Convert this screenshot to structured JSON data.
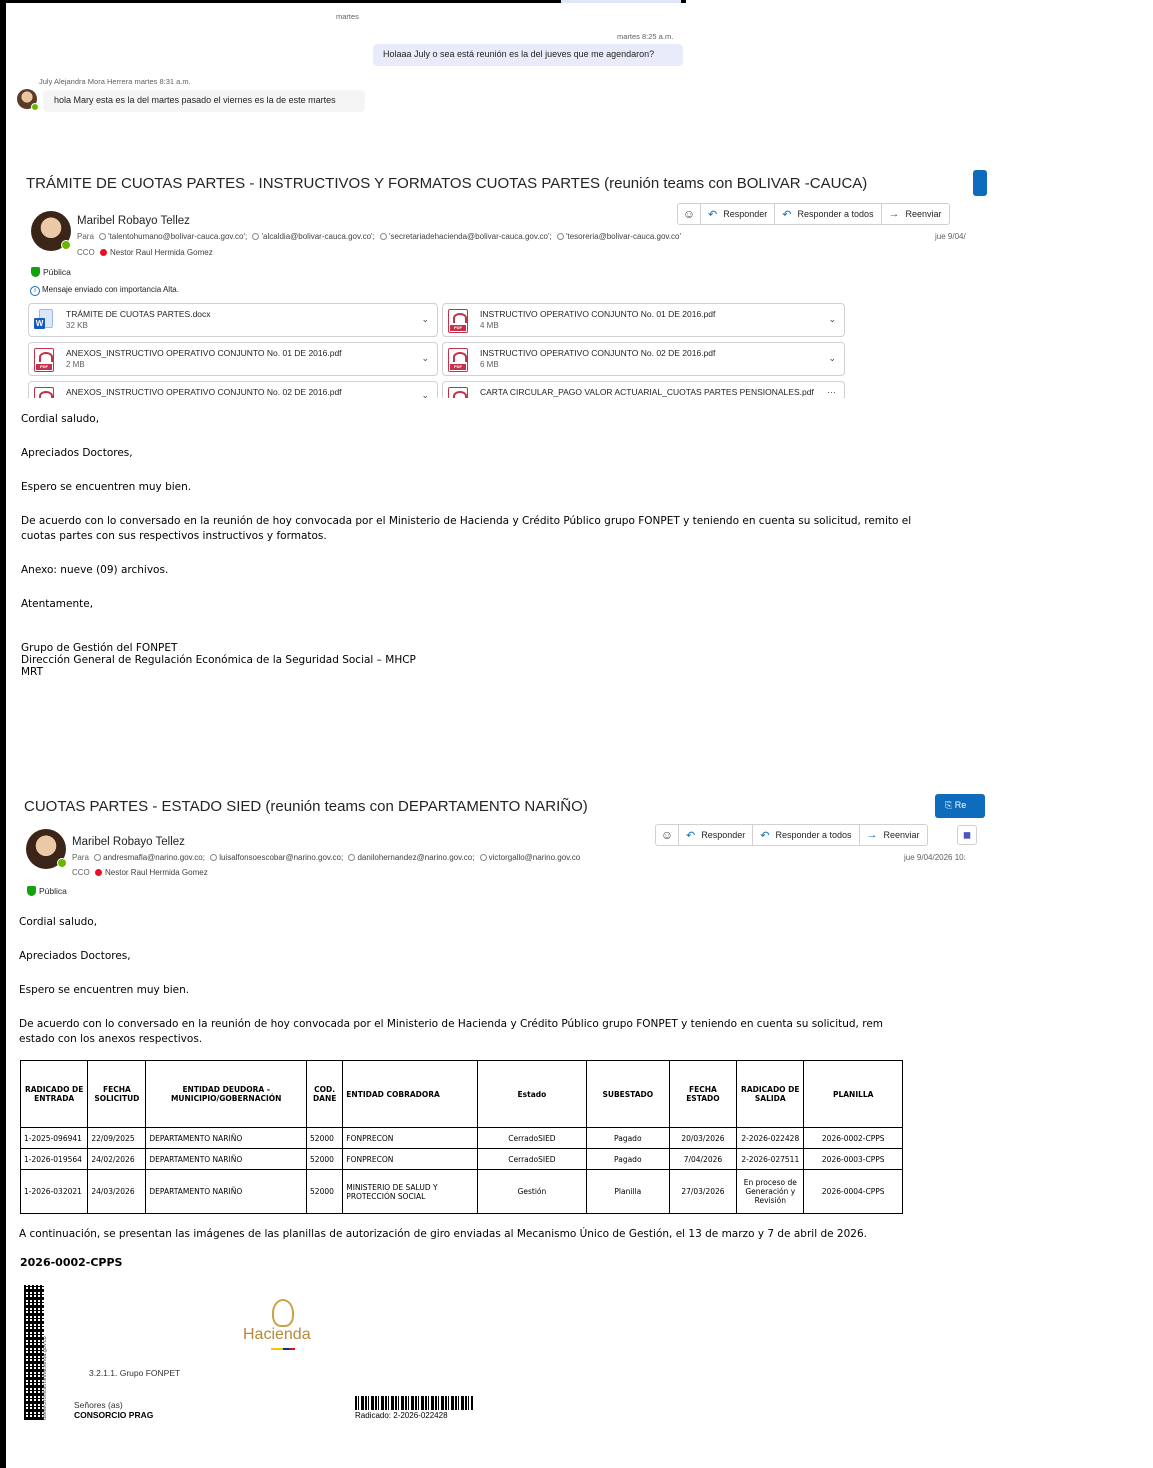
{
  "chat": {
    "day_separator": "martes",
    "my_time": "martes 8:25 a.m.",
    "my_message": "Holaaa July o sea está reunión es la del jueves que me agendaron?",
    "their_header": "July Alejandra Mora Herrera  martes 8:31 a.m.",
    "their_message": "hola Mary esta es la del martes pasado el viernes es la de este martes"
  },
  "email1": {
    "subject": "TRÁMITE DE CUOTAS PARTES  - INSTRUCTIVOS Y FORMATOS CUOTAS PARTES (reunión teams con BOLIVAR -CAUCA)",
    "sender": "Maribel Robayo Tellez",
    "to_label": "Para",
    "to": [
      "'talentohumano@bolivar-cauca.gov.co';",
      "'alcaldia@bolivar-cauca.gov.co';",
      "'secretariadehacienda@bolivar-cauca.gov.co';",
      "'tesoreria@bolivar-cauca.gov.co'"
    ],
    "cco_label": "CCO",
    "cco": "Nestor Raul Hermida Gomez",
    "date": "jue 9/04/",
    "sensitivity": "Pública",
    "importance": "Mensaje enviado con importancia Alta.",
    "attachments": [
      {
        "name": "TRÁMITE DE CUOTAS PARTES.docx",
        "size": "32 KB",
        "type": "word"
      },
      {
        "name": "INSTRUCTIVO OPERATIVO CONJUNTO No. 01 DE 2016.pdf",
        "size": "4 MB",
        "type": "pdf"
      },
      {
        "name": "ANEXOS_INSTRUCTIVO OPERATIVO CONJUNTO No. 01 DE 2016.pdf",
        "size": "2 MB",
        "type": "pdf"
      },
      {
        "name": "INSTRUCTIVO OPERATIVO CONJUNTO No. 02 DE 2016.pdf",
        "size": "6 MB",
        "type": "pdf"
      },
      {
        "name": "ANEXOS_INSTRUCTIVO OPERATIVO CONJUNTO No. 02 DE 2016.pdf",
        "size": "",
        "type": "pdf"
      },
      {
        "name": "CARTA CIRCULAR_PAGO VALOR ACTUARIAL_CUOTAS PARTES PENSIONALES.pdf",
        "size": "",
        "type": "pdf"
      }
    ],
    "body": {
      "greeting": "Cordial saludo,",
      "salutation": "Apreciados Doctores,",
      "wish": "Espero se encuentren muy bien.",
      "para1_line1": "De acuerdo con lo conversado en la reunión de hoy convocada por el Ministerio de Hacienda y Crédito Público grupo FONPET y teniendo en cuenta su solicitud, remito el",
      "para1_line2": "cuotas partes con sus respectivos instructivos y formatos.",
      "anexo": "Anexo: nueve (09) archivos.",
      "closing": "Atentamente,",
      "sig1": "Grupo de Gestión del FONPET",
      "sig2": "Dirección General de Regulación Económica de la Seguridad Social – MHCP",
      "sig3": "MRT"
    }
  },
  "actions": {
    "emoji": "☺",
    "reply": "Responder",
    "reply_all": "Responder a todos",
    "forward": "Reenviar"
  },
  "email2": {
    "subject": "CUOTAS PARTES  - ESTADO SIED (reunión teams con DEPARTAMENTO NARIÑO)",
    "tab_label": "Re",
    "sender": "Maribel Robayo Tellez",
    "to_label": "Para",
    "to": [
      "andresmafla@narino.gov.co;",
      "luisalfonsoescobar@narino.gov.co;",
      "danilohernandez@narino.gov.co;",
      "victorgallo@narino.gov.co"
    ],
    "cco_label": "CCO",
    "cco": "Nestor Raul Hermida Gomez",
    "date": "jue 9/04/2026 10:",
    "sensitivity": "Pública",
    "body": {
      "greeting": "Cordial saludo,",
      "salutation": "Apreciados Doctores,",
      "wish": "Espero se encuentren muy bien.",
      "para1_line1": "De acuerdo con lo conversado en la reunión de hoy convocada por el Ministerio de Hacienda y Crédito Público grupo FONPET y teniendo en cuenta su solicitud, rem",
      "para1_line2": "estado con los anexos respectivos.",
      "para2": "A continuación, se presentan las imágenes de las planillas de autorización de giro enviadas al Mecanismo Único de Gestión, el 13 de marzo y 7 de abril de 2026."
    },
    "table": {
      "headers": [
        "RADICADO DE ENTRADA",
        "FECHA SOLICITUD",
        "ENTIDAD DEUDORA - MUNICIPIO/GOBERNACIÓN",
        "COD. DANE",
        "ENTIDAD COBRADORA",
        "Estado",
        "SUBESTADO",
        "FECHA ESTADO",
        "RADICADO DE SALIDA",
        "PLANILLA"
      ],
      "rows": [
        [
          "1-2025-096941",
          "22/09/2025",
          "DEPARTAMENTO NARIÑO",
          "52000",
          "FONPRECON",
          "CerradoSIED",
          "Pagado",
          "20/03/2026",
          "2-2026-022428",
          "2026-0002-CPPS"
        ],
        [
          "1-2026-019564",
          "24/02/2026",
          "DEPARTAMENTO NARIÑO",
          "52000",
          "FONPRECON",
          "CerradoSIED",
          "Pagado",
          "7/04/2026",
          "2-2026-027511",
          "2026-0003-CPPS"
        ],
        [
          "1-2026-032021",
          "24/03/2026",
          "DEPARTAMENTO NARIÑO",
          "52000",
          "MINISTERIO DE SALUD Y PROTECCIÓN SOCIAL",
          "Gestión",
          "Planilla",
          "27/03/2026",
          "En proceso de Generación y Revisión",
          "2026-0004-CPPS"
        ]
      ]
    },
    "planilla_title": "2026-0002-CPPS",
    "doc": {
      "qr_text": "dsellectronica.minhacienda.gov.co",
      "logo_text": "Hacienda",
      "grupo": "3.2.1.1.  Grupo FONPET",
      "senores": "Señores (as)",
      "consorcio": "CONSORCIO PRAG",
      "radicado": "Radicado: 2-2026-022428"
    }
  }
}
